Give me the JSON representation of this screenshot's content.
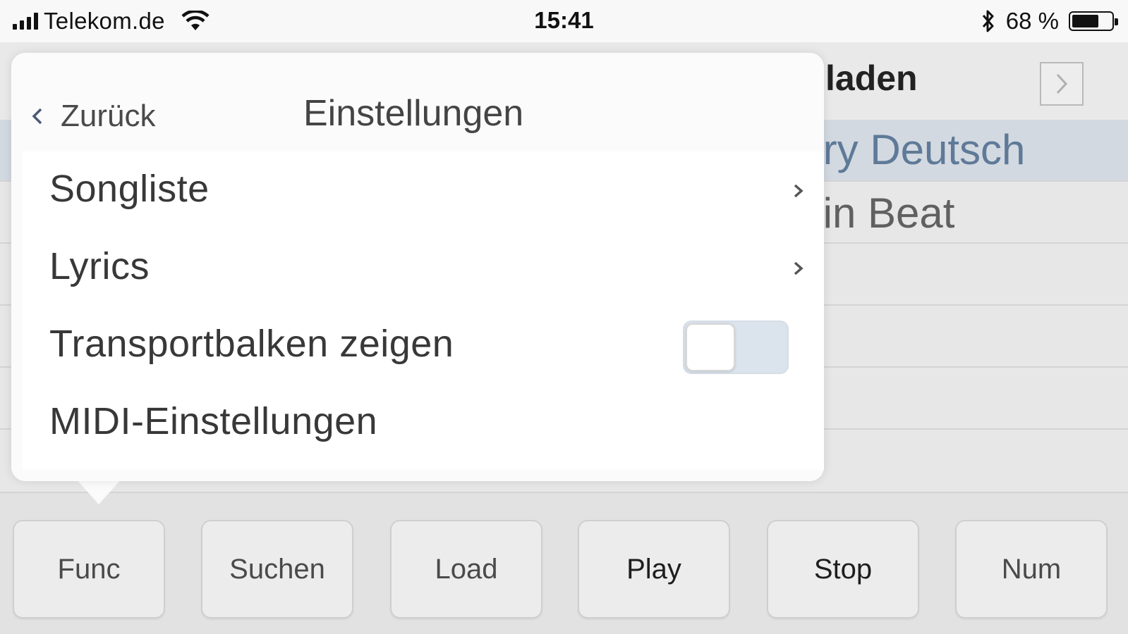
{
  "status_bar": {
    "carrier": "Telekom.de",
    "time": "15:41",
    "battery_percent": "68 %",
    "battery_level": 0.68,
    "icons": [
      "signal-icon",
      "wifi-icon",
      "bluetooth-icon",
      "battery-icon"
    ]
  },
  "background": {
    "title_fragment": "laden",
    "rows": [
      {
        "label": "try Deutsch",
        "selected": true
      },
      {
        "label": "tin Beat",
        "selected": false
      }
    ],
    "next_icon": "chevron-right-icon"
  },
  "popover": {
    "back_label": "Zurück",
    "title": "Einstellungen",
    "items": [
      {
        "label": "Songliste",
        "accessory": "chevron-right-icon"
      },
      {
        "label": "Lyrics",
        "accessory": "chevron-right-icon"
      },
      {
        "label": "Transportbalken zeigen",
        "accessory": "toggle",
        "toggle_on": false
      },
      {
        "label": "MIDI-Einstellungen",
        "accessory": "none"
      }
    ]
  },
  "toolbar": {
    "buttons": [
      "Func",
      "Suchen",
      "Load",
      "Play",
      "Stop",
      "Num"
    ]
  },
  "colors": {
    "accent_selected_text": "#5f7a98",
    "selected_row_bg": "#d3d9e1",
    "popover_bg": "#fbfbfb"
  }
}
